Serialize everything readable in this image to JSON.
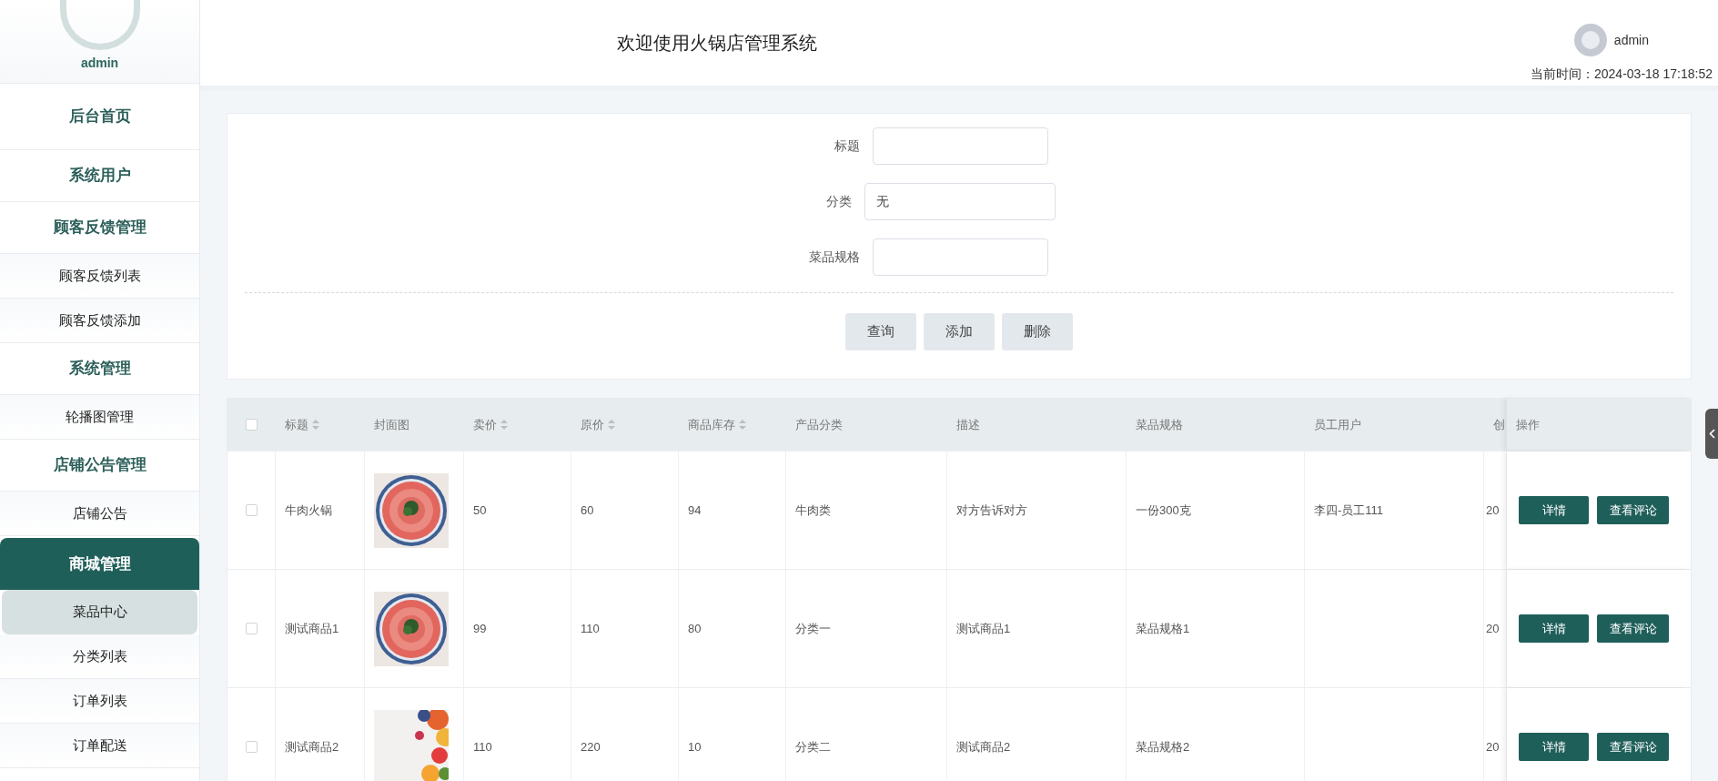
{
  "sidebar": {
    "user": "admin",
    "groups": [
      {
        "label": "后台首页",
        "selected": false
      },
      {
        "label": "系统用户",
        "selected": false
      },
      {
        "label": "顾客反馈管理",
        "selected": false,
        "children": [
          {
            "label": "顾客反馈列表",
            "selected": false
          },
          {
            "label": "顾客反馈添加",
            "selected": false
          }
        ]
      },
      {
        "label": "系统管理",
        "selected": false,
        "children": [
          {
            "label": "轮播图管理",
            "selected": false
          }
        ]
      },
      {
        "label": "店铺公告管理",
        "selected": false,
        "children": [
          {
            "label": "店铺公告",
            "selected": false
          }
        ]
      },
      {
        "label": "商城管理",
        "selected": true,
        "children": [
          {
            "label": "菜品中心",
            "selected": true
          },
          {
            "label": "分类列表",
            "selected": false
          },
          {
            "label": "订单列表",
            "selected": false
          },
          {
            "label": "订单配送",
            "selected": false
          }
        ]
      }
    ]
  },
  "header": {
    "title": "欢迎使用火锅店管理系统",
    "user": "admin",
    "time_label": "当前时间：",
    "time": "2024-03-18 17:18:52"
  },
  "search": {
    "fields": [
      {
        "label": "标题",
        "kind": "input"
      },
      {
        "label": "分类",
        "value": "无",
        "kind": "select"
      },
      {
        "label": "菜品规格",
        "kind": "input"
      }
    ],
    "buttons": [
      "查询",
      "添加",
      "删除"
    ]
  },
  "table": {
    "select_all": {
      "checked": false
    },
    "columns": [
      {
        "label": "标题",
        "sortable": true
      },
      {
        "label": "封面图",
        "sortable": false
      },
      {
        "label": "卖价",
        "sortable": true
      },
      {
        "label": "原价",
        "sortable": true
      },
      {
        "label": "商品库存",
        "sortable": true
      },
      {
        "label": "产品分类",
        "sortable": false
      },
      {
        "label": "描述",
        "sortable": false
      },
      {
        "label": "菜品规格",
        "sortable": false
      },
      {
        "label": "员工用户",
        "sortable": false
      },
      {
        "label": "创"
      },
      {
        "label": "操作",
        "sortable": false
      }
    ],
    "rows": [
      {
        "checked": false,
        "cells": [
          "牛肉火锅",
          {
            "kind": "picture"
          },
          "50",
          "60",
          "94",
          "牛肉类",
          "对方告诉对方",
          "一份300克",
          "李四-员工111",
          "20"
        ],
        "actions": [
          "详情",
          "查看评论"
        ]
      },
      {
        "checked": false,
        "cells": [
          "测试商品1",
          {
            "kind": "picture"
          },
          "99",
          "110",
          "80",
          "分类一",
          "测试商品1",
          "菜品规格1",
          "",
          "20"
        ],
        "actions": [
          "详情",
          "查看评论"
        ]
      },
      {
        "checked": false,
        "cells": [
          "测试商品2",
          {
            "kind": "picture"
          },
          "110",
          "220",
          "10",
          "分类二",
          "测试商品2",
          "菜品规格2",
          "",
          "20"
        ],
        "actions": [
          "详情",
          "查看评论"
        ]
      }
    ]
  }
}
